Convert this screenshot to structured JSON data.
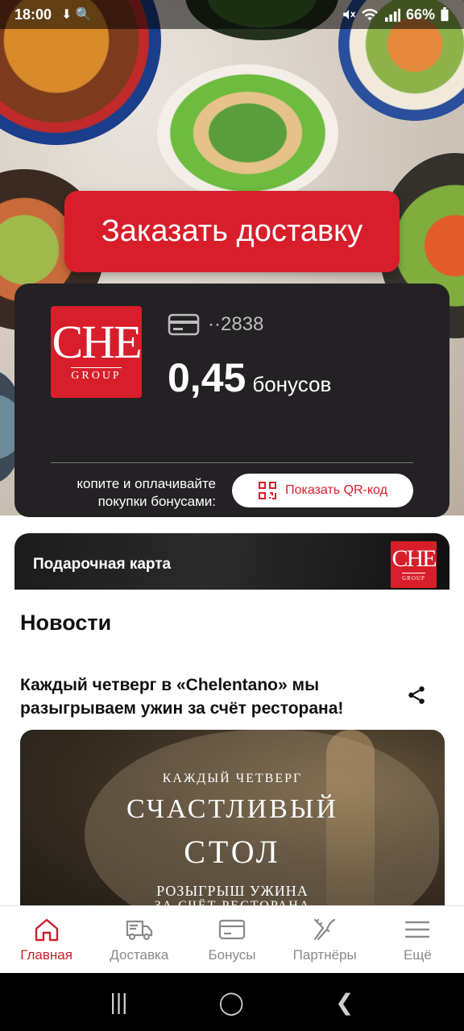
{
  "status_bar": {
    "time": "18:00",
    "left_icons": "⬇ 🔍",
    "battery": "66%"
  },
  "hero": {
    "order_button": "Заказать доставку"
  },
  "bonus_card": {
    "logo_text": "CHE",
    "logo_sub": "GROUP",
    "card_number": "··2838",
    "bonus_amount": "0,45",
    "bonus_unit": "бонусов",
    "accumulate_text": "копите и оплачивайте покупки бонусами:",
    "qr_button": "Показать QR-код"
  },
  "gift_card": {
    "label": "Подарочная карта",
    "logo_text": "CHE",
    "logo_sub": "GROUP"
  },
  "news": {
    "title": "Новости",
    "items": [
      {
        "title": "Каждый четверг в «Chelentano» мы разыгрываем ужин за счёт ресторана!",
        "image_lines": [
          "КАЖДЫЙ ЧЕТВЕРГ",
          "СЧАСТЛИВЫЙ",
          "СТОЛ",
          "РОЗЫГРЫШ УЖИНА",
          "ЗА СЧЁТ РЕСТОРАНА"
        ]
      }
    ]
  },
  "bottom_nav": {
    "items": [
      {
        "label": "Главная",
        "icon": "home-icon",
        "active": true
      },
      {
        "label": "Доставка",
        "icon": "truck-icon",
        "active": false
      },
      {
        "label": "Бонусы",
        "icon": "card-icon",
        "active": false
      },
      {
        "label": "Партнёры",
        "icon": "fork-knife-icon",
        "active": false
      },
      {
        "label": "Ещё",
        "icon": "menu-icon",
        "active": false
      }
    ]
  },
  "system_nav": {
    "recents": "|||",
    "home": "◯",
    "back": "❮"
  },
  "colors": {
    "accent": "#d81e2b",
    "card_bg": "#232123",
    "nav_active": "#c8202c",
    "nav_inactive": "#8a8a8a"
  }
}
